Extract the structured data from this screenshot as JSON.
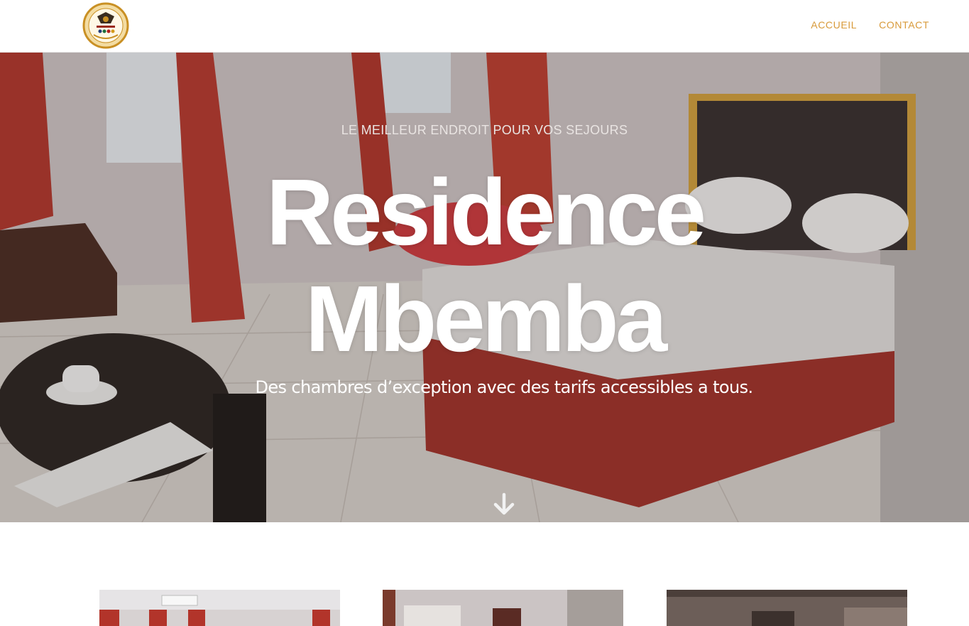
{
  "header": {
    "logo_icon": "hotel-crest-logo",
    "nav": [
      {
        "label": "ACCUEIL"
      },
      {
        "label": "CONTACT"
      }
    ],
    "accent_color": "#d89a3a"
  },
  "hero": {
    "kicker": "LE MEILLEUR ENDROIT POUR VOS SEJOURS",
    "title_line1": "Residence",
    "title_line2": "Mbemba",
    "subtitle": "Des chambres d’exception avec des tarifs accessibles a tous.",
    "scroll_icon": "arrow-down-icon"
  },
  "gallery": {
    "cards": [
      {
        "image": "room-photo-1"
      },
      {
        "image": "room-photo-2"
      },
      {
        "image": "room-photo-3"
      }
    ]
  }
}
